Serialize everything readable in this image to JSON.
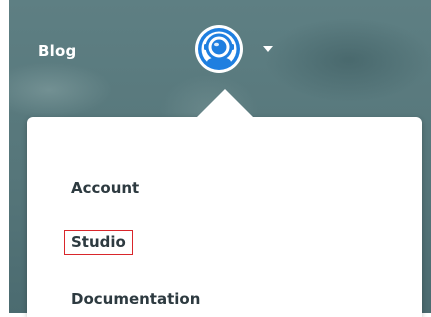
{
  "header": {
    "blog_label": "Blog",
    "avatar_icon": "astronaut-avatar-icon",
    "dropdown_icon": "caret-down-icon"
  },
  "menu": {
    "items": [
      {
        "label": "Account"
      },
      {
        "label": "Studio",
        "highlighted": true
      },
      {
        "label": "Documentation"
      }
    ]
  },
  "colors": {
    "header_bg": "#56767a",
    "menu_text": "#2d3a40",
    "highlight_border": "#d9262b",
    "avatar_ring": "#1f7fe0"
  }
}
